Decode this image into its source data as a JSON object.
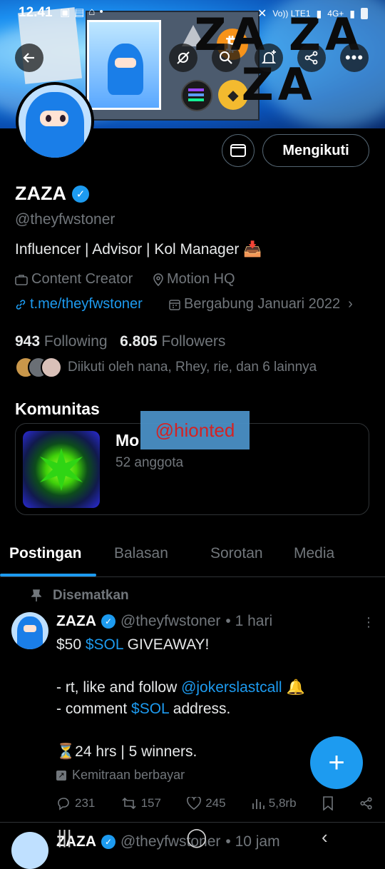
{
  "status_bar": {
    "time": "12.41",
    "network": "Vo)) LTE1",
    "network2": "4G+"
  },
  "banner": {
    "text_line1": "ZA ZA",
    "text_line2": "ZA"
  },
  "profile": {
    "name": "ZAZA",
    "handle": "@theyfwstoner",
    "bio": "Influencer | Advisor | Kol Manager 📥",
    "category": "Content Creator",
    "location": "Motion HQ",
    "link": "t.me/theyfwstoner",
    "joined": "Bergabung Januari 2022",
    "following_count": "943",
    "following_label": "Following",
    "followers_count": "6.805",
    "followers_label": "Followers",
    "followed_by": "Diikuti oleh nana, Rhey, rie, dan 6 lainnya",
    "follow_button": "Mengikuti"
  },
  "communities": {
    "section_title": "Komunitas",
    "name": "Mo",
    "members": "52 anggota",
    "watermark": "@hionted"
  },
  "tabs": [
    {
      "label": "Postingan",
      "active": true
    },
    {
      "label": "Balasan",
      "active": false
    },
    {
      "label": "Sorotan",
      "active": false
    },
    {
      "label": "Media",
      "active": false
    }
  ],
  "pinned_post": {
    "pinned_label": "Disematkan",
    "name": "ZAZA",
    "handle": "@theyfwstoner",
    "time": "• 1 hari",
    "line1_a": "$50 ",
    "line1_b": "$SOL",
    "line1_c": " GIVEAWAY!",
    "line2_a": "- rt, like and follow ",
    "line2_b": "@jokerslastcall",
    "line2_c": " 🔔",
    "line3_a": "- comment ",
    "line3_b": "$SOL",
    "line3_c": " address.",
    "line4": "⏳24 hrs | 5 winners.",
    "partnership": "Kemitraan berbayar",
    "replies": "231",
    "reposts": "157",
    "likes": "245",
    "views": "5,8rb"
  },
  "next_post": {
    "name": "ZAZA",
    "handle": "@theyfwstoner",
    "time": "• 10 jam"
  },
  "colors": {
    "accent": "#1d9bf0",
    "background": "#000000",
    "muted": "#71767b"
  }
}
